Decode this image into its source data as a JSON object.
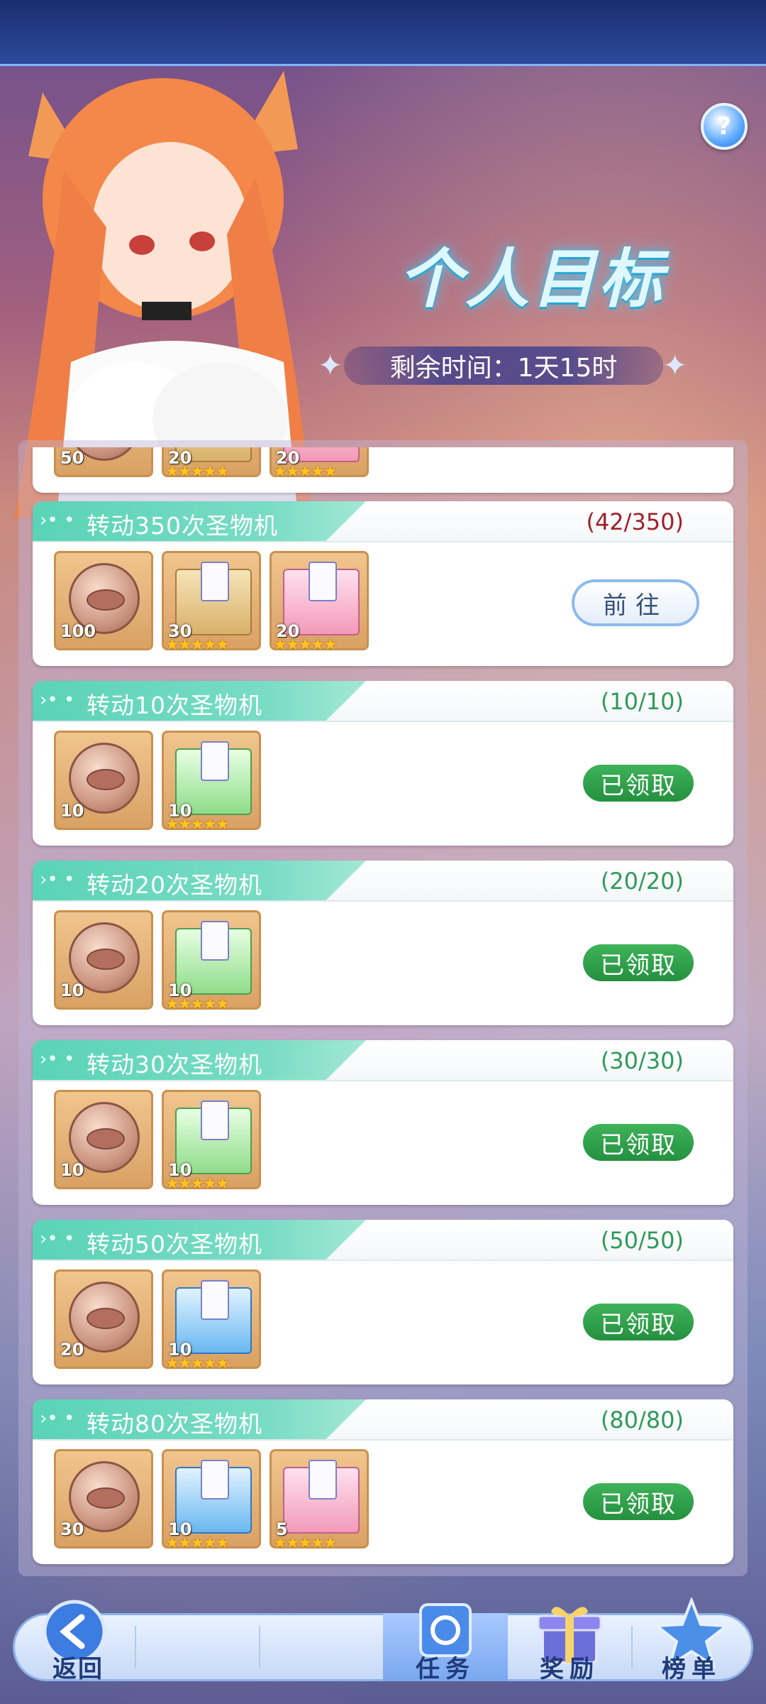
{
  "header": {
    "title": "个人目标",
    "timer": "剩余时间：1天15时",
    "help_label": "?"
  },
  "partial_card": {
    "rewards": [
      {
        "icon": "coin-icon",
        "qty": "50"
      },
      {
        "icon": "gold-box-icon",
        "qty": "20",
        "stars": "★★★★★"
      },
      {
        "icon": "pink-box-icon",
        "qty": "20",
        "stars": "★★★★★"
      }
    ]
  },
  "tasks": [
    {
      "title": "转动350次圣物机",
      "progress": "(42/350)",
      "status": "goto",
      "action_label": "前往",
      "rewards": [
        {
          "icon": "coin-icon",
          "qty": "100"
        },
        {
          "icon": "gold-box-icon",
          "qty": "30",
          "stars": "★★★★★"
        },
        {
          "icon": "pink-box-icon",
          "qty": "20",
          "stars": "★★★★★"
        }
      ]
    },
    {
      "title": "转动10次圣物机",
      "progress": "(10/10)",
      "status": "claimed",
      "action_label": "已领取",
      "rewards": [
        {
          "icon": "coin-icon",
          "qty": "10"
        },
        {
          "icon": "green-box-icon",
          "qty": "10",
          "stars": "★★★★★"
        }
      ]
    },
    {
      "title": "转动20次圣物机",
      "progress": "(20/20)",
      "status": "claimed",
      "action_label": "已领取",
      "rewards": [
        {
          "icon": "coin-icon",
          "qty": "10"
        },
        {
          "icon": "green-box-icon",
          "qty": "10",
          "stars": "★★★★★"
        }
      ]
    },
    {
      "title": "转动30次圣物机",
      "progress": "(30/30)",
      "status": "claimed",
      "action_label": "已领取",
      "rewards": [
        {
          "icon": "coin-icon",
          "qty": "10"
        },
        {
          "icon": "green-box-icon",
          "qty": "10",
          "stars": "★★★★★"
        }
      ]
    },
    {
      "title": "转动50次圣物机",
      "progress": "(50/50)",
      "status": "claimed",
      "action_label": "已领取",
      "rewards": [
        {
          "icon": "coin-icon",
          "qty": "20"
        },
        {
          "icon": "blue-box-icon",
          "qty": "10",
          "stars": "★★★★★"
        }
      ]
    },
    {
      "title": "转动80次圣物机",
      "progress": "(80/80)",
      "status": "claimed",
      "action_label": "已领取",
      "rewards": [
        {
          "icon": "coin-icon",
          "qty": "30"
        },
        {
          "icon": "blue-box-icon",
          "qty": "10",
          "stars": "★★★★★"
        },
        {
          "icon": "pink-box-icon",
          "qty": "5",
          "stars": "★★★★★"
        }
      ]
    }
  ],
  "bottom_nav": {
    "back": "返回",
    "tasks": "任务",
    "rewards": "奖励",
    "ranking": "榜单",
    "active": "tasks"
  }
}
